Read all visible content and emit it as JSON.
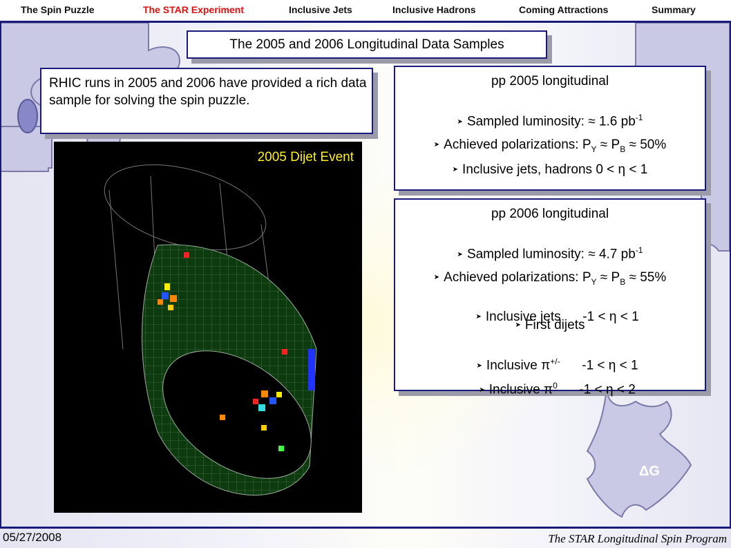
{
  "nav": {
    "items": [
      {
        "label": "The Spin Puzzle",
        "active": false
      },
      {
        "label": "The STAR Experiment",
        "active": true
      },
      {
        "label": "Inclusive Jets",
        "active": false
      },
      {
        "label": "Inclusive Hadrons",
        "active": false
      },
      {
        "label": "Coming Attractions",
        "active": false
      },
      {
        "label": "Summary",
        "active": false
      }
    ]
  },
  "slide": {
    "title": "The 2005 and 2006 Longitudinal Data Samples",
    "intro": "RHIC runs in 2005 and 2006 have provided a rich data sample for solving the spin puzzle.",
    "image_caption": "2005 Dijet Event",
    "puzzle_label": "ΔG"
  },
  "run2005": {
    "title": "pp 2005 longitudinal",
    "lum_pre": "Sampled luminosity:  ≈  1.6 pb",
    "lum_sup": "-1",
    "pol_pre": "Achieved polarizations: P",
    "pol_sub1": "Y",
    "pol_mid": " ≈ P",
    "pol_sub2": "B",
    "pol_post": " ≈  50%",
    "eta_text": "Inclusive jets, hadrons 0 < η < 1"
  },
  "run2006": {
    "title": "pp 2006 longitudinal",
    "lum_pre": "Sampled luminosity:  ≈  4.7 pb",
    "lum_sup": "-1",
    "pol_pre": "Achieved polarizations: P",
    "pol_sub1": "Y",
    "pol_mid": " ≈ P",
    "pol_sub2": "B",
    "pol_post": " ≈  55%",
    "jets_text": "Inclusive jets      -1 < η < 1",
    "dijets_text": "First dijets",
    "pipm_pre": "Inclusive π",
    "pipm_sup": "+/-",
    "pipm_post": "      -1 < η < 1",
    "pi0_pre": "Inclusive π",
    "pi0_sup": "0",
    "pi0_post": "      -1 < η < 2"
  },
  "footer": {
    "date": "05/27/2008",
    "program": "The STAR Longitudinal Spin Program"
  },
  "colors": {
    "accent": "#1a1a7a",
    "active_nav": "#dd1111",
    "caption": "#ffee22",
    "puzzle": "#c9c9e6"
  }
}
